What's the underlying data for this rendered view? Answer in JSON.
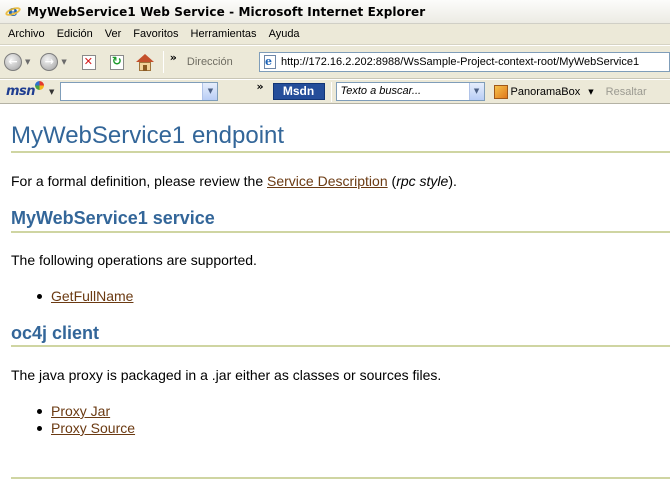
{
  "window": {
    "title": "MyWebService1 Web Service - Microsoft Internet Explorer"
  },
  "menu": {
    "items": [
      "Archivo",
      "Edición",
      "Ver",
      "Favoritos",
      "Herramientas",
      "Ayuda"
    ]
  },
  "toolbar": {
    "address_label": "Dirección",
    "address_value": "http://172.16.2.202:8988/WsSample-Project-context-root/MyWebService1",
    "chevron": "»"
  },
  "linksbar": {
    "msn_label": "msn",
    "msdn_label": "Msdn",
    "search_placeholder": "Texto a buscar...",
    "panorama_label": "PanoramaBox",
    "highlight_label": "Resaltar",
    "chevron": "»"
  },
  "page": {
    "heading": "MyWebService1 endpoint",
    "intro_prefix": "For a formal definition, please review the ",
    "intro_link": "Service Description",
    "intro_open": " (",
    "intro_style": "rpc style",
    "intro_close": ").",
    "service_heading": "MyWebService1 service",
    "operations_text": "The following operations are supported.",
    "operations": [
      "GetFullName"
    ],
    "client_heading": "oc4j client",
    "proxy_text": "The java proxy is packaged in a .jar either as classes or sources files.",
    "proxy_links": [
      "Proxy Jar",
      "Proxy Source"
    ]
  },
  "colors": {
    "heading": "#336699",
    "link": "#6b3a12",
    "rule": "#cfd5a2",
    "chrome": "#ece9d8"
  }
}
